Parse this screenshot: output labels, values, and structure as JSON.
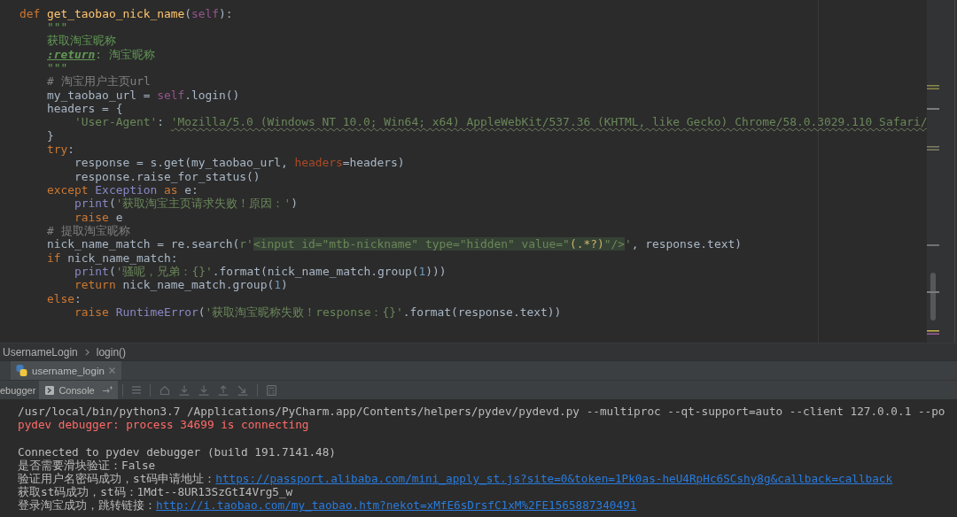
{
  "editor": {
    "lines": [
      {
        "tokens": [
          {
            "text": "def ",
            "kind": "keyword"
          },
          {
            "text": "get_taobao_nick_name",
            "kind": "function"
          },
          {
            "text": "(",
            "kind": "text"
          },
          {
            "text": "self",
            "kind": "self"
          },
          {
            "text": "):",
            "kind": "text"
          }
        ]
      },
      {
        "tokens": [
          {
            "text": "    \"\"\"",
            "kind": "docstring"
          }
        ]
      },
      {
        "tokens": [
          {
            "text": "    获取淘宝昵称",
            "kind": "docstring"
          }
        ]
      },
      {
        "tokens": [
          {
            "text": "    :return",
            "kind": "doctag"
          },
          {
            "text": ": 淘宝昵称",
            "kind": "docstring"
          }
        ]
      },
      {
        "tokens": [
          {
            "text": "    \"\"\"",
            "kind": "docstring"
          }
        ]
      },
      {
        "tokens": [
          {
            "text": "    # 淘宝用户主页url",
            "kind": "comment"
          }
        ]
      },
      {
        "tokens": [
          {
            "text": "    my_taobao_url = ",
            "kind": "text"
          },
          {
            "text": "self",
            "kind": "self"
          },
          {
            "text": ".login()",
            "kind": "text"
          }
        ]
      },
      {
        "tokens": [
          {
            "text": "    headers = {",
            "kind": "text"
          }
        ]
      },
      {
        "tokens": [
          {
            "text": "        'User-Agent'",
            "kind": "string"
          },
          {
            "text": ": ",
            "kind": "text"
          },
          {
            "text": "'Mozilla/5.0 (Windows NT 10.0; Win64; x64) AppleWebKit/537.36 (KHTML, like Gecko) Chrome/58.0.3029.110 Safari/",
            "kind": "flagged"
          }
        ]
      },
      {
        "tokens": [
          {
            "text": "    }",
            "kind": "text"
          }
        ]
      },
      {
        "tokens": [
          {
            "text": "    try",
            "kind": "keyword"
          },
          {
            "text": ":",
            "kind": "text"
          }
        ]
      },
      {
        "tokens": [
          {
            "text": "        response = s.get(my_taobao_url, ",
            "kind": "text"
          },
          {
            "text": "headers",
            "kind": "argname"
          },
          {
            "text": "=headers)",
            "kind": "text"
          }
        ]
      },
      {
        "tokens": [
          {
            "text": "        response.raise_for_status()",
            "kind": "text"
          }
        ]
      },
      {
        "tokens": [
          {
            "text": "    except ",
            "kind": "keyword"
          },
          {
            "text": "Exception",
            "kind": "builtin"
          },
          {
            "text": " as",
            "kind": "keyword"
          },
          {
            "text": " e:",
            "kind": "text"
          }
        ]
      },
      {
        "tokens": [
          {
            "text": "        print",
            "kind": "builtin"
          },
          {
            "text": "(",
            "kind": "text"
          },
          {
            "text": "'获取淘宝主页请求失败！原因：'",
            "kind": "string"
          },
          {
            "text": ")",
            "kind": "text"
          }
        ]
      },
      {
        "tokens": [
          {
            "text": "        raise",
            "kind": "keyword"
          },
          {
            "text": " e",
            "kind": "text"
          }
        ]
      },
      {
        "tokens": [
          {
            "text": "    # 提取淘宝昵称",
            "kind": "comment"
          }
        ]
      },
      {
        "tokens": [
          {
            "text": "    nick_name_match = re.search(",
            "kind": "text"
          },
          {
            "text": "r'",
            "kind": "string"
          },
          {
            "text": "<input id=\"mtb-nickname\" type=\"hidden\" value=\"",
            "kind": "regex"
          },
          {
            "text": "(.*?)",
            "kind": "regexgroup"
          },
          {
            "text": "\"/>",
            "kind": "regex"
          },
          {
            "text": "'",
            "kind": "string"
          },
          {
            "text": ", response.text)",
            "kind": "text"
          }
        ]
      },
      {
        "tokens": [
          {
            "text": "    if",
            "kind": "keyword"
          },
          {
            "text": " nick_name_match:",
            "kind": "text"
          }
        ]
      },
      {
        "tokens": [
          {
            "text": "        print",
            "kind": "builtin"
          },
          {
            "text": "(",
            "kind": "text"
          },
          {
            "text": "'骚呢，兄弟：{}'",
            "kind": "string"
          },
          {
            "text": ".format(nick_name_match.group(",
            "kind": "text"
          },
          {
            "text": "1",
            "kind": "number"
          },
          {
            "text": ")))",
            "kind": "text"
          }
        ]
      },
      {
        "tokens": [
          {
            "text": "        return",
            "kind": "keyword"
          },
          {
            "text": " nick_name_match.group(",
            "kind": "text"
          },
          {
            "text": "1",
            "kind": "number"
          },
          {
            "text": ")",
            "kind": "text"
          }
        ]
      },
      {
        "tokens": [
          {
            "text": "    else",
            "kind": "keyword"
          },
          {
            "text": ":",
            "kind": "text"
          }
        ]
      },
      {
        "tokens": [
          {
            "text": "        raise ",
            "kind": "keyword"
          },
          {
            "text": "RuntimeError",
            "kind": "builtin"
          },
          {
            "text": "(",
            "kind": "text"
          },
          {
            "text": "'获取淘宝昵称失败！response：{}'",
            "kind": "string"
          },
          {
            "text": ".format(response.text))",
            "kind": "text"
          }
        ]
      }
    ]
  },
  "breadcrumbs": [
    "UsernameLogin",
    "login()"
  ],
  "debug_window": {
    "session_tabs": [
      {
        "label": "username_login",
        "selected": true
      }
    ],
    "tabs": [
      {
        "label": "ebugger",
        "selected": false
      },
      {
        "label": "Console",
        "selected": true
      }
    ]
  },
  "console": {
    "groups": [
      {
        "lines": [
          {
            "kind": "text",
            "text": "/usr/local/bin/python3.7 /Applications/PyCharm.app/Contents/helpers/pydev/pydevd.py --multiproc --qt-support=auto --client 127.0.0.1 --po"
          },
          {
            "kind": "error",
            "text": "pydev debugger: process 34699 is connecting"
          }
        ]
      },
      {
        "lines": [
          {
            "kind": "text",
            "text": "Connected to pydev debugger (build 191.7141.48)"
          },
          {
            "kind": "text",
            "text": "是否需要滑块验证：False"
          },
          {
            "kind": "link",
            "text": "验证用户名密码成功，st码申请地址：",
            "url": "https://passport.alibaba.com/mini_apply_st.js?site=0&token=1Pk0as-heU4RpHc6SCshy8g&callback=callback"
          },
          {
            "kind": "text",
            "text": "获取st码成功，st码：1Mdt--8UR13SzGtI4Vrg5_w"
          },
          {
            "kind": "link",
            "text": "登录淘宝成功，跳转链接：",
            "url": "http://i.taobao.com/my_taobao.htm?nekot=xMfE6sDrsfC1xM%2FE1565887340491"
          }
        ]
      }
    ]
  }
}
